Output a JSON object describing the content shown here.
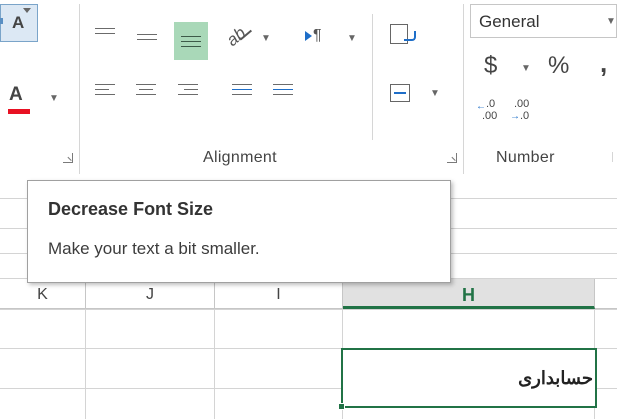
{
  "ribbon": {
    "font_group": {
      "decrease_font_glyph": "A",
      "font_color_glyph": "A",
      "font_color": "#e81123"
    },
    "alignment_group": {
      "label": "Alignment",
      "orientation_glyph": "ab",
      "rtl_glyph": "¶"
    },
    "number_group": {
      "label": "Number",
      "format_value": "General",
      "currency_symbol": "$",
      "percent_symbol": "%",
      "comma_symbol": ",",
      "increase_decimal_top": ".0",
      "increase_decimal_bottom": ".00",
      "decrease_decimal_top": ".00",
      "decrease_decimal_bottom": ".0"
    },
    "accent_color": "#217346",
    "active_bg": "#a9d8b8"
  },
  "tooltip": {
    "title": "Decrease Font Size",
    "description": "Make your text a bit smaller."
  },
  "grid": {
    "columns": [
      {
        "label": "K",
        "selected": false
      },
      {
        "label": "J",
        "selected": false
      },
      {
        "label": "I",
        "selected": false
      },
      {
        "label": "H",
        "selected": true
      }
    ],
    "active_cell_value": "حسابداری"
  }
}
